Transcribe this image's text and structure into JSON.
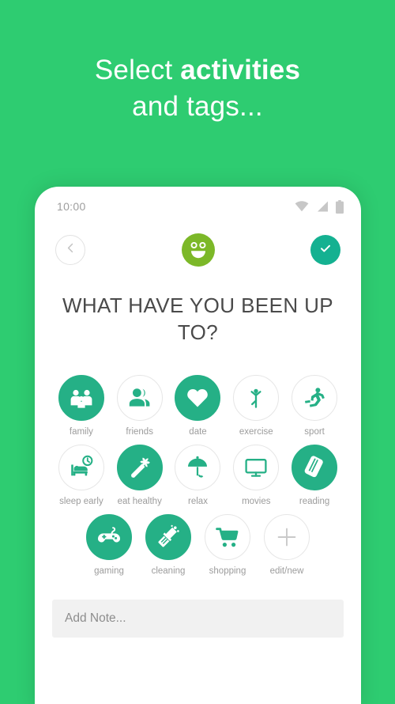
{
  "promo": {
    "line1_plain": "Select ",
    "line1_bold": "activities",
    "line2": "and tags..."
  },
  "colors": {
    "background_green": "#2ECC71",
    "accent_teal": "#25B086",
    "check_button": "#14B191",
    "mood_green": "#7CB828",
    "label_gray": "#9C9C9C",
    "note_bg": "#F1F1F1"
  },
  "statusbar": {
    "time": "10:00",
    "icons": [
      "wifi-icon",
      "signal-icon",
      "battery-icon"
    ]
  },
  "header": {
    "back_icon": "chevron-left-icon",
    "mood_icon": "smiley-face-icon",
    "confirm_icon": "check-icon"
  },
  "screen": {
    "title": "WHAT HAVE YOU BEEN UP TO?"
  },
  "activities": {
    "rows": [
      [
        {
          "label": "family",
          "icon": "family-icon",
          "selected": true
        },
        {
          "label": "friends",
          "icon": "friends-icon",
          "selected": false
        },
        {
          "label": "date",
          "icon": "heart-icon",
          "selected": true
        },
        {
          "label": "exercise",
          "icon": "exercise-icon",
          "selected": false
        },
        {
          "label": "sport",
          "icon": "running-icon",
          "selected": false
        }
      ],
      [
        {
          "label": "sleep early",
          "icon": "bed-clock-icon",
          "selected": false
        },
        {
          "label": "eat healthy",
          "icon": "carrot-icon",
          "selected": true
        },
        {
          "label": "relax",
          "icon": "umbrella-icon",
          "selected": false
        },
        {
          "label": "movies",
          "icon": "monitor-icon",
          "selected": false
        },
        {
          "label": "reading",
          "icon": "book-icon",
          "selected": true
        }
      ],
      [
        {
          "label": "gaming",
          "icon": "gamepad-icon",
          "selected": true
        },
        {
          "label": "cleaning",
          "icon": "broom-icon",
          "selected": true
        },
        {
          "label": "shopping",
          "icon": "cart-icon",
          "selected": false
        },
        {
          "label": "edit/new",
          "icon": "plus-icon",
          "selected": false
        }
      ]
    ]
  },
  "note": {
    "value": "",
    "placeholder": "Add Note..."
  }
}
